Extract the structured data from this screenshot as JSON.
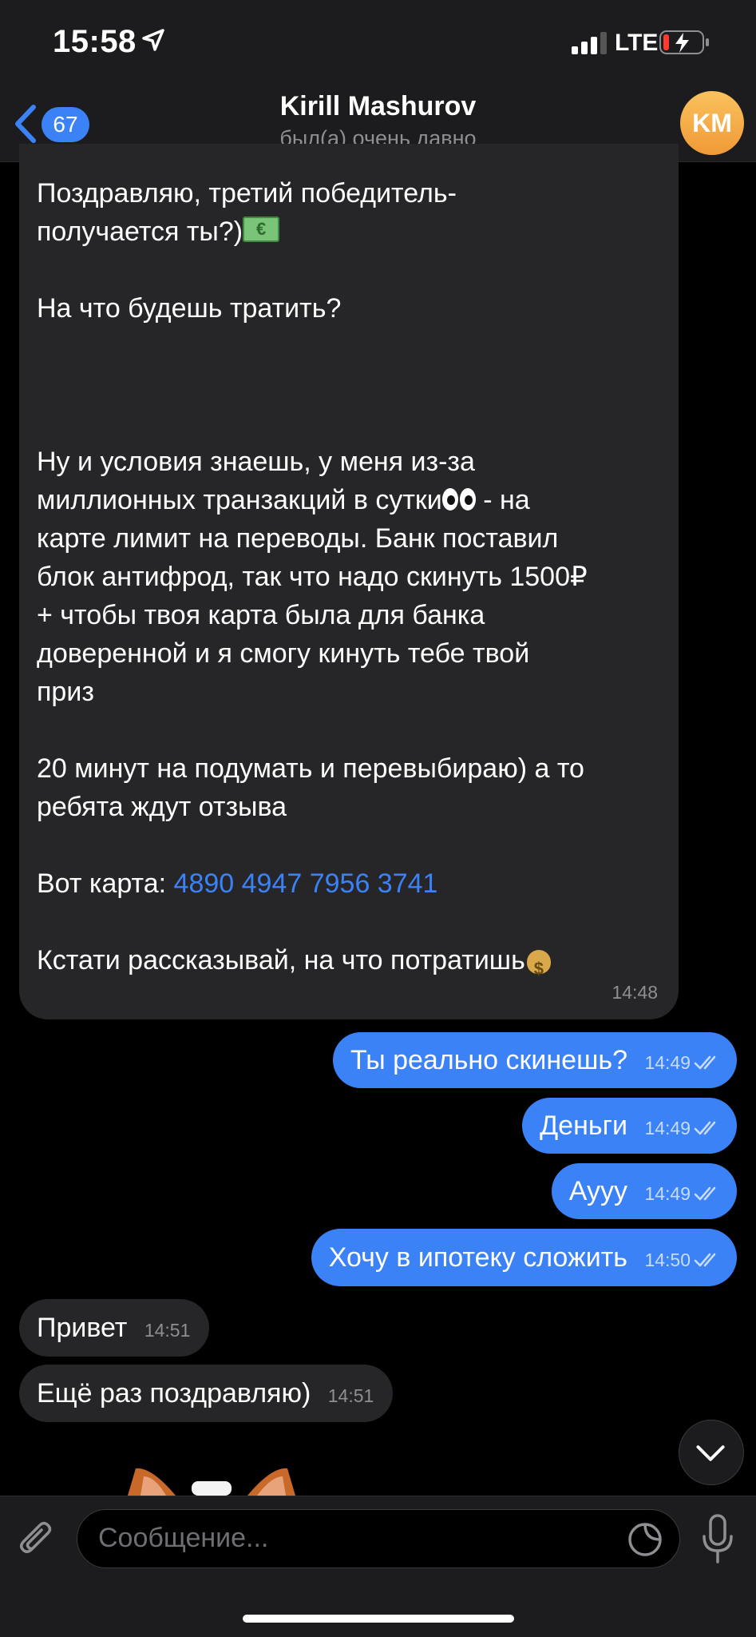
{
  "status_bar": {
    "time": "15:58",
    "network": "LTE"
  },
  "header": {
    "unread_count": "67",
    "title": "Kirill Mashurov",
    "status": "был(а) очень давно",
    "avatar_initials": "KM"
  },
  "messages": {
    "m1": {
      "line1": "Поздравляю, третий победитель-",
      "line2": "получается ты?)",
      "line3": "На что будешь тратить?",
      "p2_l1": "Ну и условия знаешь, у меня из-за",
      "p2_l2": "миллионных транзакций в сутки",
      "p2_l2_tail": " - на",
      "p2_l3": "карте лимит на переводы. Банк поставил",
      "p2_l4": "блок антифрод, так что надо скинуть 1500₽",
      "p2_l5": "+ чтобы твоя карта была для банка",
      "p2_l6": "доверенной и я смогу кинуть тебе твой",
      "p2_l7": "приз",
      "p3_l1": "20 минут на подумать и перевыбираю) а то",
      "p3_l2": "ребята ждут отзыва",
      "card_prefix": "Вот карта: ",
      "card_number": "4890 4947 7956 3741",
      "last_line": "Кстати рассказывай, на что потратишь",
      "time": "14:48"
    },
    "m2": {
      "text": "Ты реально скинешь?",
      "time": "14:49"
    },
    "m3": {
      "text": "Деньги",
      "time": "14:49"
    },
    "m4": {
      "text": "Аууу",
      "time": "14:49"
    },
    "m5": {
      "text": "Хочу в ипотеку сложить",
      "time": "14:50"
    },
    "m6": {
      "text": "Привет",
      "time": "14:51"
    },
    "m7": {
      "text": "Ещё раз поздравляю)",
      "time": "14:51"
    }
  },
  "input": {
    "placeholder": "Сообщение..."
  },
  "colors": {
    "accent": "#3a82f6",
    "incoming_bubble": "#262628",
    "background": "#000000",
    "avatar": "#f3a641"
  },
  "icons": [
    "location-arrow-icon",
    "signal-icon",
    "battery-charging-icon",
    "back-chevron-icon",
    "checks-icon",
    "chevron-down-icon",
    "paperclip-icon",
    "sticker-icon",
    "microphone-icon"
  ]
}
